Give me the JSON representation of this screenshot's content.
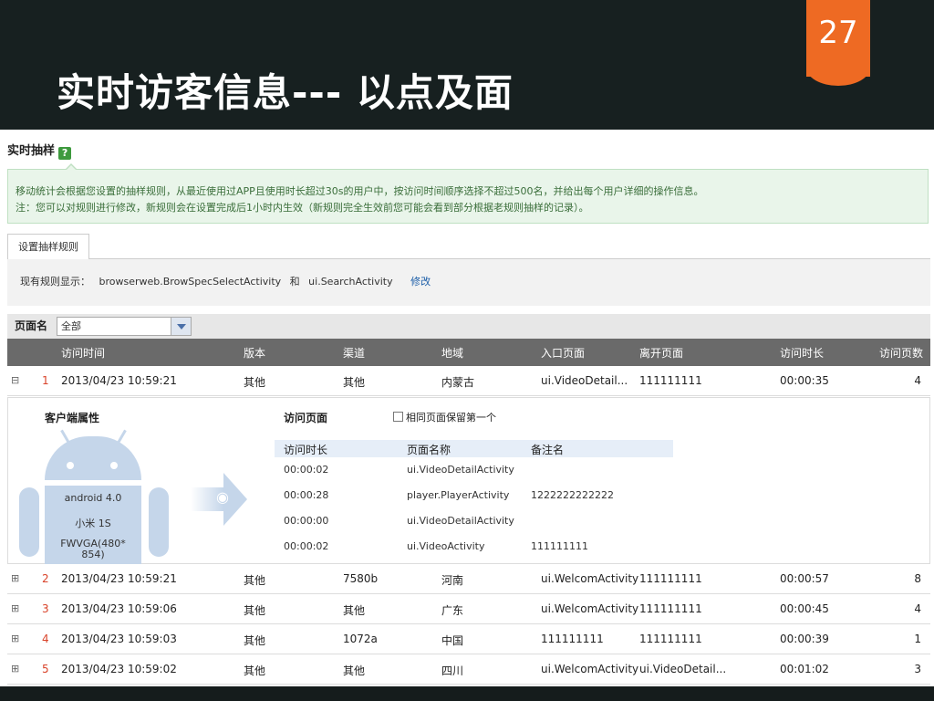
{
  "slide": {
    "title": "实时访客信息--- 以点及面",
    "page_number": "27",
    "accent_color": "#ee6a23",
    "background_color": "#172020"
  },
  "section": {
    "title": "实时抽样",
    "help_icon": "?"
  },
  "info": {
    "line1": "移动统计会根据您设置的抽样规则，从最近使用过APP且使用时长超过30s的用户中，按访问时间顺序选择不超过500名，并给出每个用户详细的操作信息。",
    "line2": "注：您可以对规则进行修改，新规则会在设置完成后1小时内生效（新规则完全生效前您可能会看到部分根据老规则抽样的记录）。"
  },
  "rules": {
    "tab_label": "设置抽样规则",
    "current_label": "现有规则显示：",
    "rule_a": "browserweb.BrowSpecSelectActivity",
    "and": "和",
    "rule_b": "ui.SearchActivity",
    "edit_label": "修改"
  },
  "filter": {
    "label": "页面名",
    "selected": "全部"
  },
  "table": {
    "headers": [
      "访问时间",
      "版本",
      "渠道",
      "地域",
      "入口页面",
      "离开页面",
      "访问时长",
      "访问页数"
    ],
    "rows": [
      {
        "expand": "⊟",
        "idx": "1",
        "time": "2013/04/23 10:59:21",
        "version": "其他",
        "channel": "其他",
        "region": "内蒙古",
        "entry": "ui.VideoDetail...",
        "exit": "111111111",
        "duration": "00:00:35",
        "pages": "4"
      },
      {
        "expand": "⊞",
        "idx": "2",
        "time": "2013/04/23 10:59:21",
        "version": "其他",
        "channel": "7580b",
        "region": "河南",
        "entry": "ui.WelcomActivity",
        "exit": "111111111",
        "duration": "00:00:57",
        "pages": "8"
      },
      {
        "expand": "⊞",
        "idx": "3",
        "time": "2013/04/23 10:59:06",
        "version": "其他",
        "channel": "其他",
        "region": "广东",
        "entry": "ui.WelcomActivity",
        "exit": "111111111",
        "duration": "00:00:45",
        "pages": "4"
      },
      {
        "expand": "⊞",
        "idx": "4",
        "time": "2013/04/23 10:59:03",
        "version": "其他",
        "channel": "1072a",
        "region": "中国",
        "entry": "111111111",
        "exit": "111111111",
        "duration": "00:00:39",
        "pages": "1"
      },
      {
        "expand": "⊞",
        "idx": "5",
        "time": "2013/04/23 10:59:02",
        "version": "其他",
        "channel": "其他",
        "region": "四川",
        "entry": "ui.WelcomActivity",
        "exit": "ui.VideoDetail...",
        "duration": "00:01:02",
        "pages": "3"
      }
    ]
  },
  "detail": {
    "client_title": "客户端属性",
    "os": "android 4.0",
    "device": "小米 1S",
    "resolution": "FWVGA(480*854)",
    "visit_title": "访问页面",
    "keep_first_label": "相同页面保留第一个",
    "visit_headers": [
      "访问时长",
      "页面名称",
      "备注名"
    ],
    "visits": [
      {
        "duration": "00:00:02",
        "page": "ui.VideoDetailActivity",
        "note": ""
      },
      {
        "duration": "00:00:28",
        "page": "player.PlayerActivity",
        "note": "1222222222222"
      },
      {
        "duration": "00:00:00",
        "page": "ui.VideoDetailActivity",
        "note": ""
      },
      {
        "duration": "00:00:02",
        "page": "ui.VideoActivity",
        "note": "111111111"
      }
    ]
  }
}
